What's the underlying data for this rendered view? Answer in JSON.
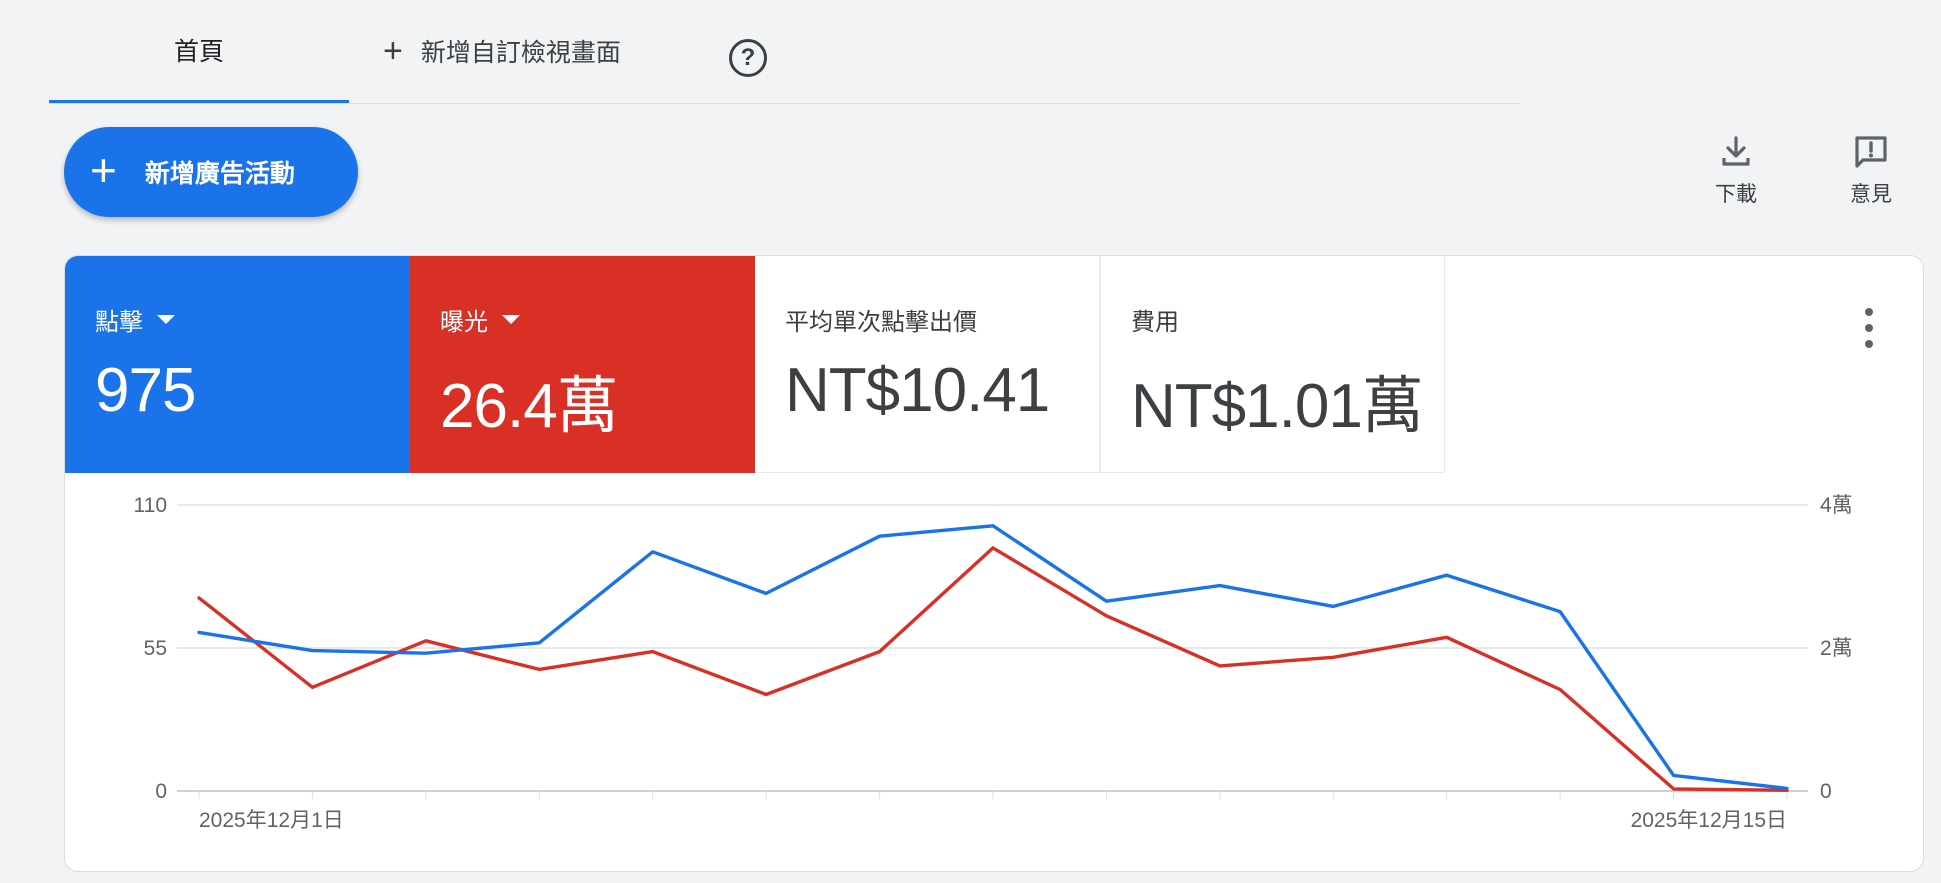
{
  "tabs": {
    "home": "首頁",
    "add_view": "新增自訂檢視畫面"
  },
  "fab": {
    "label": "新增廣告活動"
  },
  "actions": {
    "download": "下載",
    "feedback": "意見"
  },
  "metrics": [
    {
      "label": "點擊",
      "value": "975",
      "color": "#1a73e8"
    },
    {
      "label": "曝光",
      "value": "26.4萬",
      "color": "#d93025"
    },
    {
      "label": "平均單次點擊出價",
      "value": "NT$10.41"
    },
    {
      "label": "費用",
      "value": "NT$1.01萬"
    }
  ],
  "chart_data": {
    "type": "line",
    "x": [
      "2025-12-01",
      "2025-12-02",
      "2025-12-03",
      "2025-12-04",
      "2025-12-05",
      "2025-12-06",
      "2025-12-07",
      "2025-12-08",
      "2025-12-09",
      "2025-12-10",
      "2025-12-11",
      "2025-12-12",
      "2025-12-13",
      "2025-12-14",
      "2025-12-15"
    ],
    "x_tick_labels": [
      "2025年12月1日",
      "2025年12月15日"
    ],
    "left_axis": {
      "ylim": [
        0,
        110
      ],
      "ticks": [
        "0",
        "55",
        "110"
      ]
    },
    "right_axis": {
      "ylim": [
        0,
        40000
      ],
      "ticks": [
        "0",
        "2萬",
        "4萬"
      ]
    },
    "series": [
      {
        "name": "點擊",
        "axis": "left",
        "color": "#1a73e8",
        "values": [
          61,
          54,
          53,
          57,
          92,
          76,
          98,
          102,
          73,
          79,
          71,
          83,
          69,
          6,
          1
        ]
      },
      {
        "name": "曝光",
        "axis": "right",
        "color": "#d93025",
        "values": [
          27000,
          14500,
          21000,
          17000,
          19500,
          13500,
          19500,
          34000,
          24500,
          17500,
          18700,
          21500,
          14200,
          300,
          100
        ]
      }
    ],
    "grid": true
  }
}
